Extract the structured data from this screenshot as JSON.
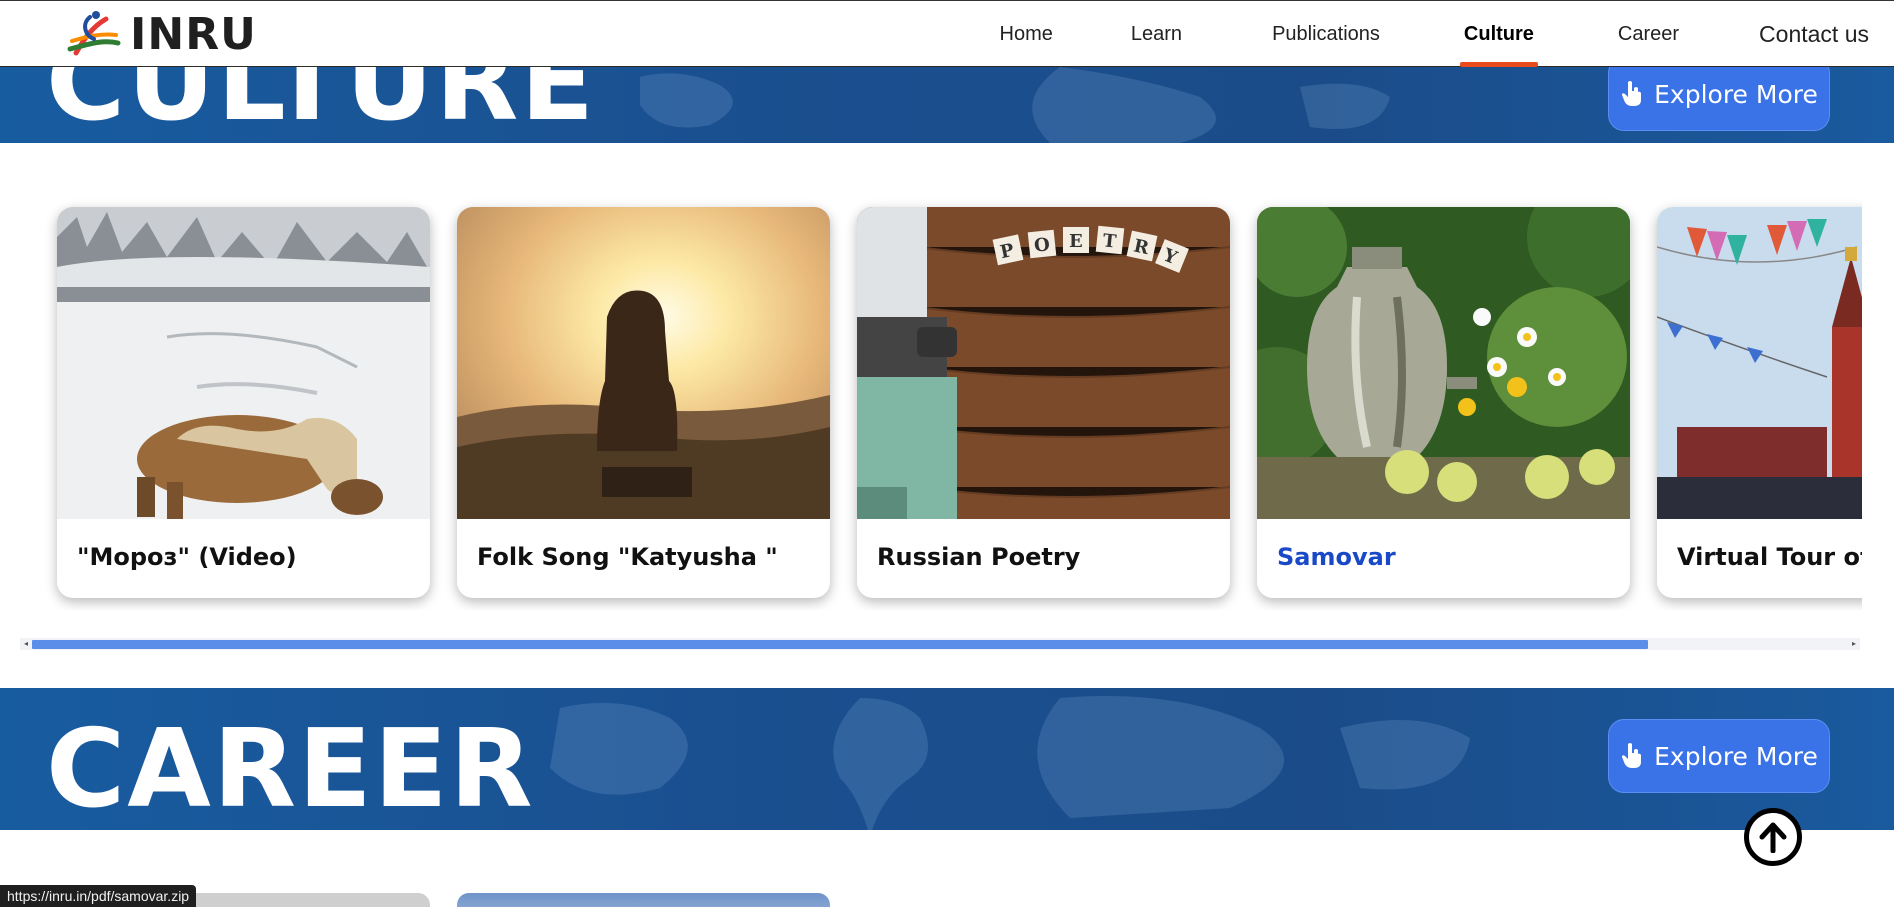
{
  "header": {
    "logo_text": "INRU",
    "nav": [
      {
        "label": "Home",
        "active": false
      },
      {
        "label": "Learn",
        "active": false
      },
      {
        "label": "Publications",
        "active": false
      },
      {
        "label": "Culture",
        "active": true
      },
      {
        "label": "Career",
        "active": false
      },
      {
        "label": "Contact us",
        "active": false
      }
    ],
    "active_indicator_color": "#e94b1b"
  },
  "sections": {
    "culture": {
      "title": "CULTURE",
      "button_label": "Explore More"
    },
    "career": {
      "title": "CAREER",
      "button_label": "Explore More"
    }
  },
  "cards": [
    {
      "title": "\"Мороз\" (Video)",
      "image": "pony-in-snow"
    },
    {
      "title": "Folk Song \"Katyusha \"",
      "image": "girl-at-sunset"
    },
    {
      "title": "Russian Poetry",
      "image": "typewriter-poetry-tiles"
    },
    {
      "title": "Samovar",
      "image": "samovar-with-flowers",
      "hovered": true
    },
    {
      "title": "Virtual Tour of R",
      "image": "kremlin-tower-festival"
    }
  ],
  "scrollbar": {
    "position_fraction": 0.0,
    "visible_fraction": 0.89
  },
  "status_bar": {
    "url": "https://inru.in/pdf/samovar.zip"
  },
  "colors": {
    "banner": "#1a4f8f",
    "button": "#3a72e8",
    "link_hover": "#1a49c7",
    "scroll_thumb": "#5a8ee8"
  },
  "icons": {
    "explore": "pointing-hand-icon",
    "back_to_top": "arrow-up-circle-icon"
  }
}
